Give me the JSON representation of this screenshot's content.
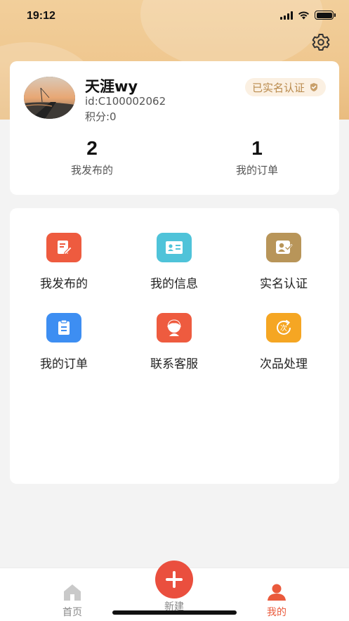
{
  "status_bar": {
    "time": "19:12"
  },
  "profile": {
    "name": "天涯wy",
    "id": "id:C100002062",
    "points": "积分:0",
    "verified_label": "已实名认证"
  },
  "stats": [
    {
      "value": "2",
      "label": "我发布的"
    },
    {
      "value": "1",
      "label": "我的订单"
    }
  ],
  "menu": [
    {
      "label": "我发布的",
      "icon": "edit-icon",
      "color": "#ee5b3f"
    },
    {
      "label": "我的信息",
      "icon": "id-card-icon",
      "color": "#4fc3d9"
    },
    {
      "label": "实名认证",
      "icon": "verified-user-icon",
      "color": "#b89559"
    },
    {
      "label": "我的订单",
      "icon": "clipboard-icon",
      "color": "#3d8ef2"
    },
    {
      "label": "联系客服",
      "icon": "customer-service-icon",
      "color": "#ee5b3f"
    },
    {
      "label": "次品处理",
      "icon": "defect-icon",
      "color": "#f5a623"
    }
  ],
  "tabs": [
    {
      "label": "首页",
      "icon": "home-icon"
    },
    {
      "label": "新建",
      "icon": "plus-icon"
    },
    {
      "label": "我的",
      "icon": "person-icon"
    }
  ],
  "colors": {
    "accent": "#ea5a3c",
    "header_gradient": "#f2cf9b",
    "badge_text": "#b98a4c"
  }
}
